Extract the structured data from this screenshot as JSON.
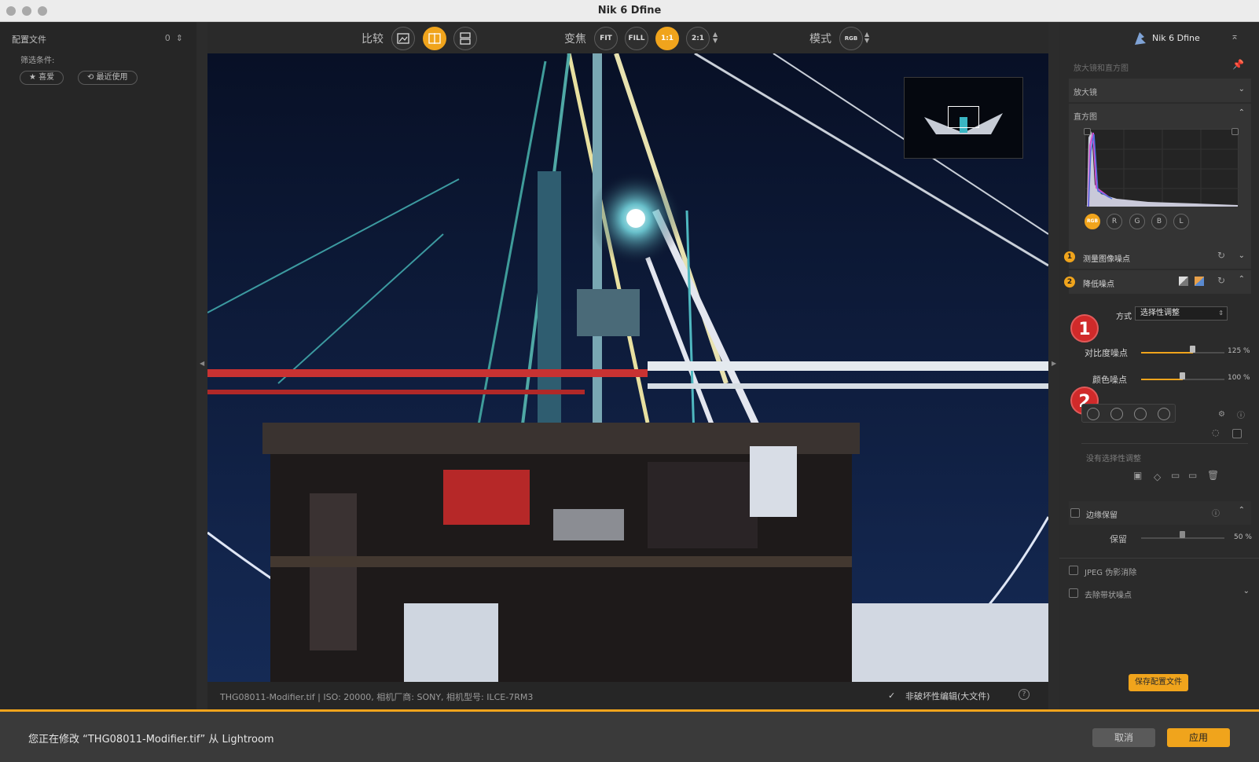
{
  "window": {
    "title": "Nik 6 Dfine"
  },
  "left_panel": {
    "profiles_label": "配置文件",
    "profiles_count": "0",
    "filter_label": "筛选条件:",
    "filter_favorites": "★ 喜爱",
    "filter_recent": "⟲ 最近使用"
  },
  "toolbar": {
    "compare_label": "比较",
    "zoom_label": "变焦",
    "zoom_fit": "FIT",
    "zoom_fill": "FILL",
    "zoom_1_1": "1:1",
    "zoom_2_1": "2:1",
    "mode_label": "模式",
    "mode_value": "RGB"
  },
  "status": {
    "file_info": "THG08011-Modifier.tif   |   ISO: 20000, 相机厂商: SONY, 相机型号: ILCE-7RM3",
    "non_destructive": "非破坏性编辑(大文件)",
    "help": "?"
  },
  "right_panel": {
    "plugin_name": "Nik 6 Dfine",
    "loupe_hist_title": "放大镜和直方图",
    "loupe": "放大镜",
    "histogram": "直方图",
    "channels": [
      "RGB",
      "R",
      "G",
      "B",
      "L"
    ],
    "step1_num": "1",
    "step1_title": "测量图像噪点",
    "step2_num": "2",
    "step2_title": "降低噪点",
    "method_label": "方式",
    "method_value": "选择性调整",
    "contrast_noise_label": "对比度噪点",
    "contrast_noise_value": "125 %",
    "color_noise_label": "颜色噪点",
    "color_noise_value": "100 %",
    "no_selective": "没有选择性调整",
    "edge_preserve": "边缘保留",
    "preserve_label": "保留",
    "preserve_value": "50 %",
    "jpeg_artifact": "JPEG 伪影消除",
    "debanding": "去除带状噪点",
    "save_profile": "保存配置文件"
  },
  "callouts": [
    "1",
    "2"
  ],
  "bottom_bar": {
    "message": "您正在修改 “THG08011-Modifier.tif” 从 Lightroom",
    "cancel": "取消",
    "apply": "应用"
  },
  "colors": {
    "accent": "#f0a41c",
    "callout": "#d02a2a"
  }
}
